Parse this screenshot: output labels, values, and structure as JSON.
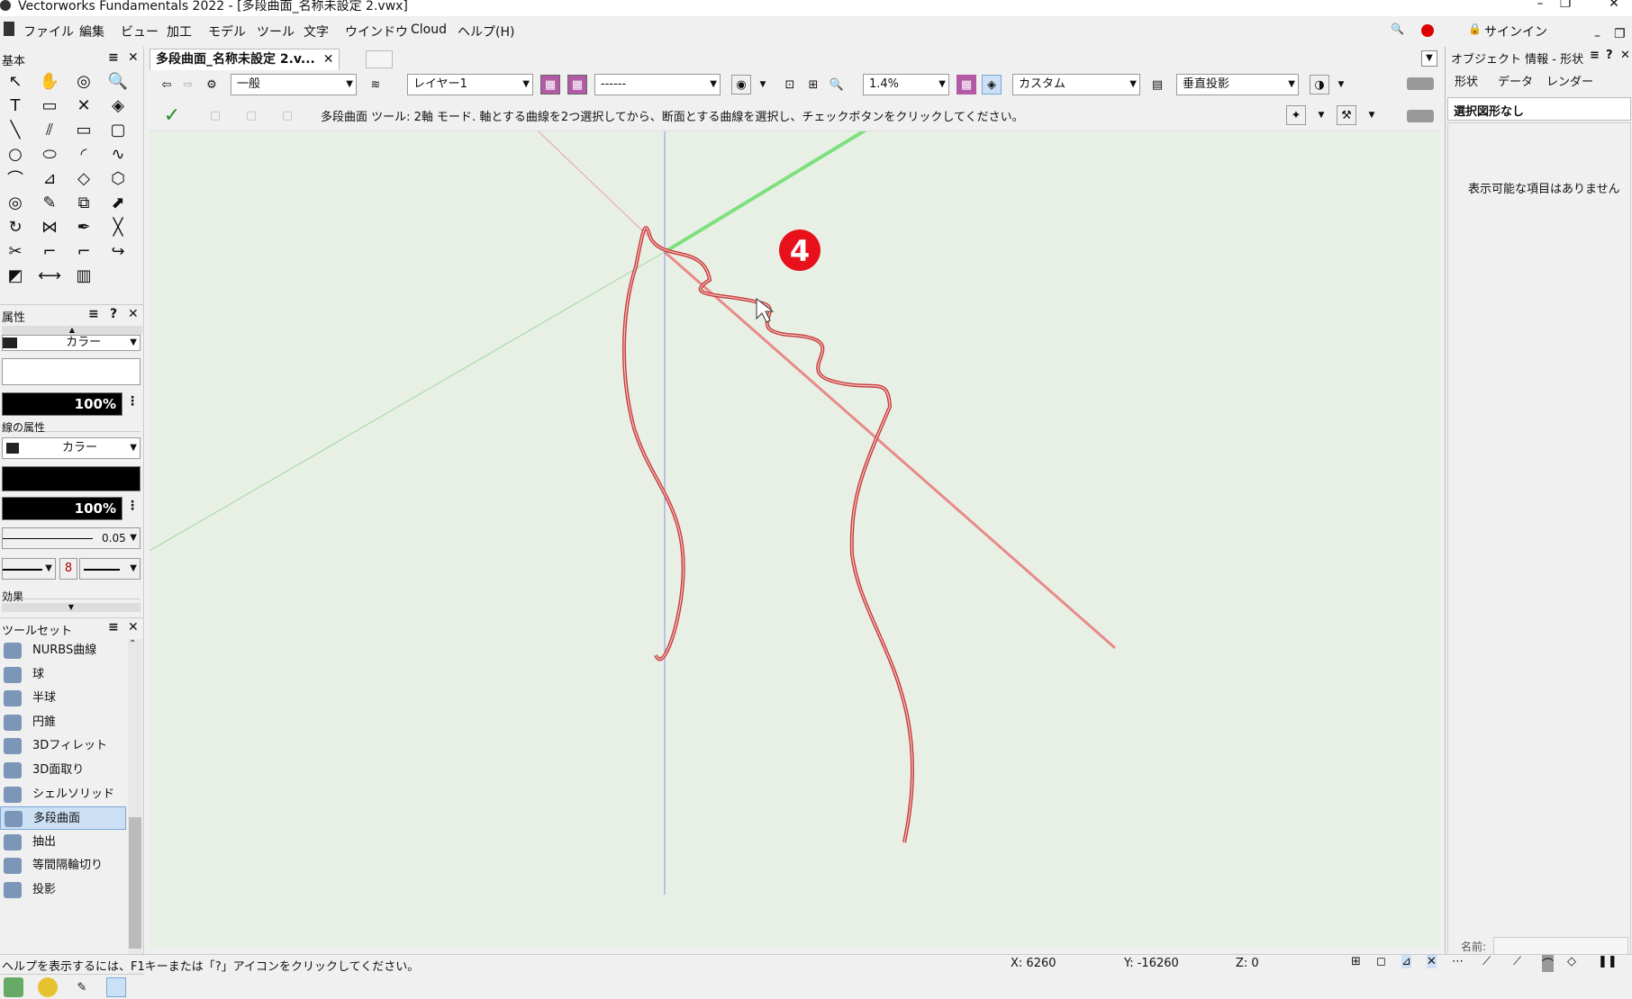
{
  "window": {
    "title": "Vectorworks Fundamentals 2022 - [多段曲面_名称未設定 2.vwx]"
  },
  "menu": [
    "ファイル",
    "編集",
    "ビュー",
    "加工",
    "モデル",
    "ツール",
    "文字",
    "ウインドウ",
    "Cloud",
    "ヘルプ(H)"
  ],
  "signin": "サインイン",
  "left": {
    "basic_title": "基本",
    "attr_title": "属性",
    "fill_type": "カラー",
    "fill_opacity": "100%",
    "line_attr_title": "線の属性",
    "line_type": "カラー",
    "line_opacity": "100%",
    "line_weight": "0.05",
    "effects_title": "効果",
    "toolset_title": "ツールセット",
    "toolset_items": [
      "NURBS曲線",
      "球",
      "半球",
      "円錐",
      "3Dフィレット",
      "3D面取り",
      "シェルソリッド",
      "多段曲面",
      "抽出",
      "等間隔輪切り",
      "投影"
    ],
    "selected_tool_index": 7
  },
  "doc_tab": "多段曲面_名称未設定 2.v...",
  "view_bar": {
    "class_combo": "一般",
    "layer_combo": "レイヤー1",
    "viewport_combo": "------",
    "zoom": "1.4%",
    "render_combo": "カスタム",
    "projection_combo": "垂直投影"
  },
  "mode_bar": {
    "message": "多段曲面 ツール: 2軸 モード. 軸とする曲線を2つ選択してから、断面とする曲線を選択し、チェックボタンをクリックしてください。"
  },
  "canvas": {
    "step_badge": "4"
  },
  "right": {
    "title": "オブジェクト 情報 - 形状",
    "tabs": [
      "形状",
      "データ",
      "レンダー"
    ],
    "selection_header": "選択図形なし",
    "empty_message": "表示可能な項目はありません",
    "name_label": "名前:"
  },
  "status": {
    "help": "ヘルプを表示するには、F1キーまたは「?」アイコンをクリックしてください。",
    "x": "X: 6260",
    "y": "Y: -16260",
    "z": "Z: 0"
  }
}
